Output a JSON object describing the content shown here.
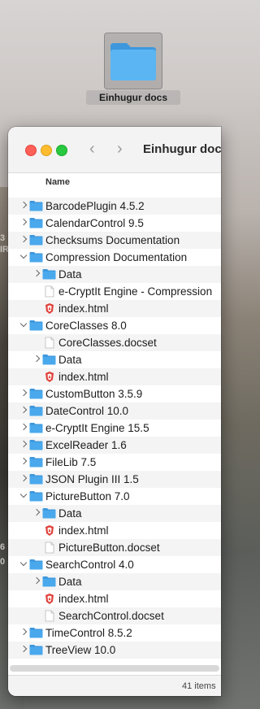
{
  "desktop": {
    "folder_label": "Einhugur docs",
    "wallpaper_fragments": [
      "3",
      "IR",
      "6",
      "0"
    ]
  },
  "window": {
    "title": "Einhugur docs",
    "column_header": "Name",
    "status": "41 items"
  },
  "files": [
    {
      "name": "BarcodePlugin 4.5.2",
      "type": "folder",
      "level": 0,
      "expanded": false
    },
    {
      "name": "CalendarControl 9.5",
      "type": "folder",
      "level": 0,
      "expanded": false
    },
    {
      "name": "Checksums Documentation",
      "type": "folder",
      "level": 0,
      "expanded": false
    },
    {
      "name": "Compression Documentation",
      "type": "folder",
      "level": 0,
      "expanded": true
    },
    {
      "name": "Data",
      "type": "folder",
      "level": 1,
      "expanded": false
    },
    {
      "name": "e-CryptIt Engine - Compression",
      "type": "file",
      "level": 1
    },
    {
      "name": "index.html",
      "type": "html",
      "level": 1
    },
    {
      "name": "CoreClasses 8.0",
      "type": "folder",
      "level": 0,
      "expanded": true
    },
    {
      "name": "CoreClasses.docset",
      "type": "file",
      "level": 1
    },
    {
      "name": "Data",
      "type": "folder",
      "level": 1,
      "expanded": false
    },
    {
      "name": "index.html",
      "type": "html",
      "level": 1
    },
    {
      "name": "CustomButton 3.5.9",
      "type": "folder",
      "level": 0,
      "expanded": false
    },
    {
      "name": "DateControl 10.0",
      "type": "folder",
      "level": 0,
      "expanded": false
    },
    {
      "name": "e-CryptIt Engine 15.5",
      "type": "folder",
      "level": 0,
      "expanded": false
    },
    {
      "name": "ExcelReader 1.6",
      "type": "folder",
      "level": 0,
      "expanded": false
    },
    {
      "name": "FileLib 7.5",
      "type": "folder",
      "level": 0,
      "expanded": false
    },
    {
      "name": "JSON Plugin III 1.5",
      "type": "folder",
      "level": 0,
      "expanded": false
    },
    {
      "name": "PictureButton 7.0",
      "type": "folder",
      "level": 0,
      "expanded": true
    },
    {
      "name": "Data",
      "type": "folder",
      "level": 1,
      "expanded": false
    },
    {
      "name": "index.html",
      "type": "html",
      "level": 1
    },
    {
      "name": "PictureButton.docset",
      "type": "file",
      "level": 1
    },
    {
      "name": "SearchControl 4.0",
      "type": "folder",
      "level": 0,
      "expanded": true
    },
    {
      "name": "Data",
      "type": "folder",
      "level": 1,
      "expanded": false
    },
    {
      "name": "index.html",
      "type": "html",
      "level": 1
    },
    {
      "name": "SearchControl.docset",
      "type": "file",
      "level": 1
    },
    {
      "name": "TimeControl 8.5.2",
      "type": "folder",
      "level": 0,
      "expanded": false
    },
    {
      "name": "TreeView 10.0",
      "type": "folder",
      "level": 0,
      "expanded": false
    }
  ],
  "colors": {
    "folder": "#4aa8ec",
    "folder_tab": "#3d97dc",
    "html_badge": "#e0413a"
  }
}
